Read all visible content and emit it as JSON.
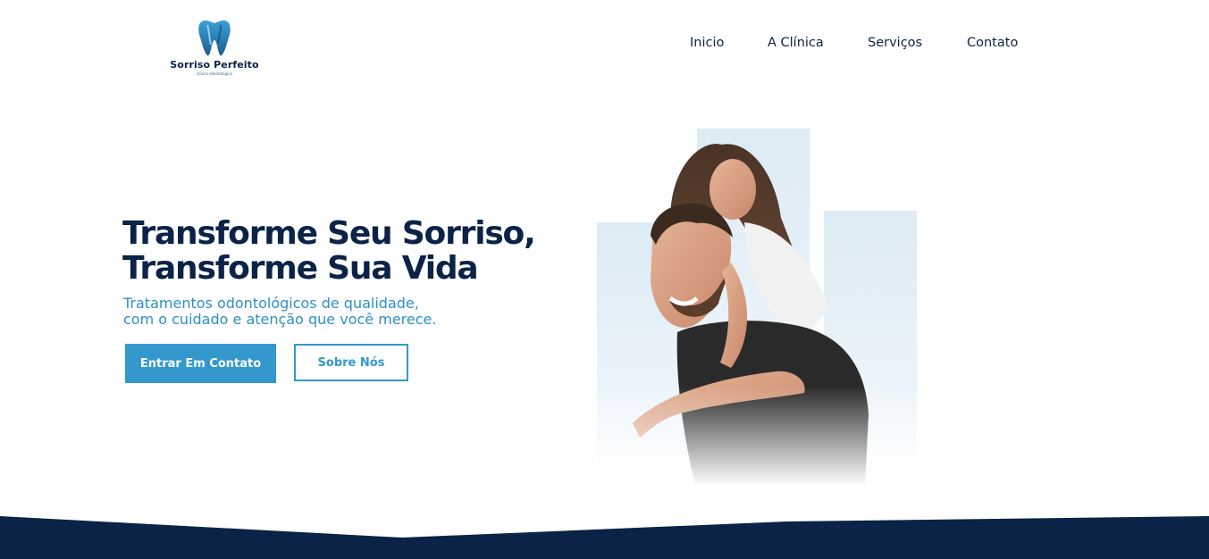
{
  "logo": {
    "name": "Sorriso Perfeito",
    "subtitle": "clínica odontológica"
  },
  "nav": {
    "items": [
      "Inicio",
      "A Clínica",
      "Serviços",
      "Contato"
    ]
  },
  "hero": {
    "title_line1": "Transforme Seu Sorriso,",
    "title_line2": "Transforme Sua Vida",
    "subtitle_line1": "Tratamentos odontológicos de qualidade,",
    "subtitle_line2": "com o cuidado e atenção que você merece.",
    "primary_button": "Entrar Em Contato",
    "secondary_button": "Sobre Nós"
  },
  "colors": {
    "navy": "#0a2347",
    "accent": "#3399cc",
    "background": "#ffffff"
  }
}
